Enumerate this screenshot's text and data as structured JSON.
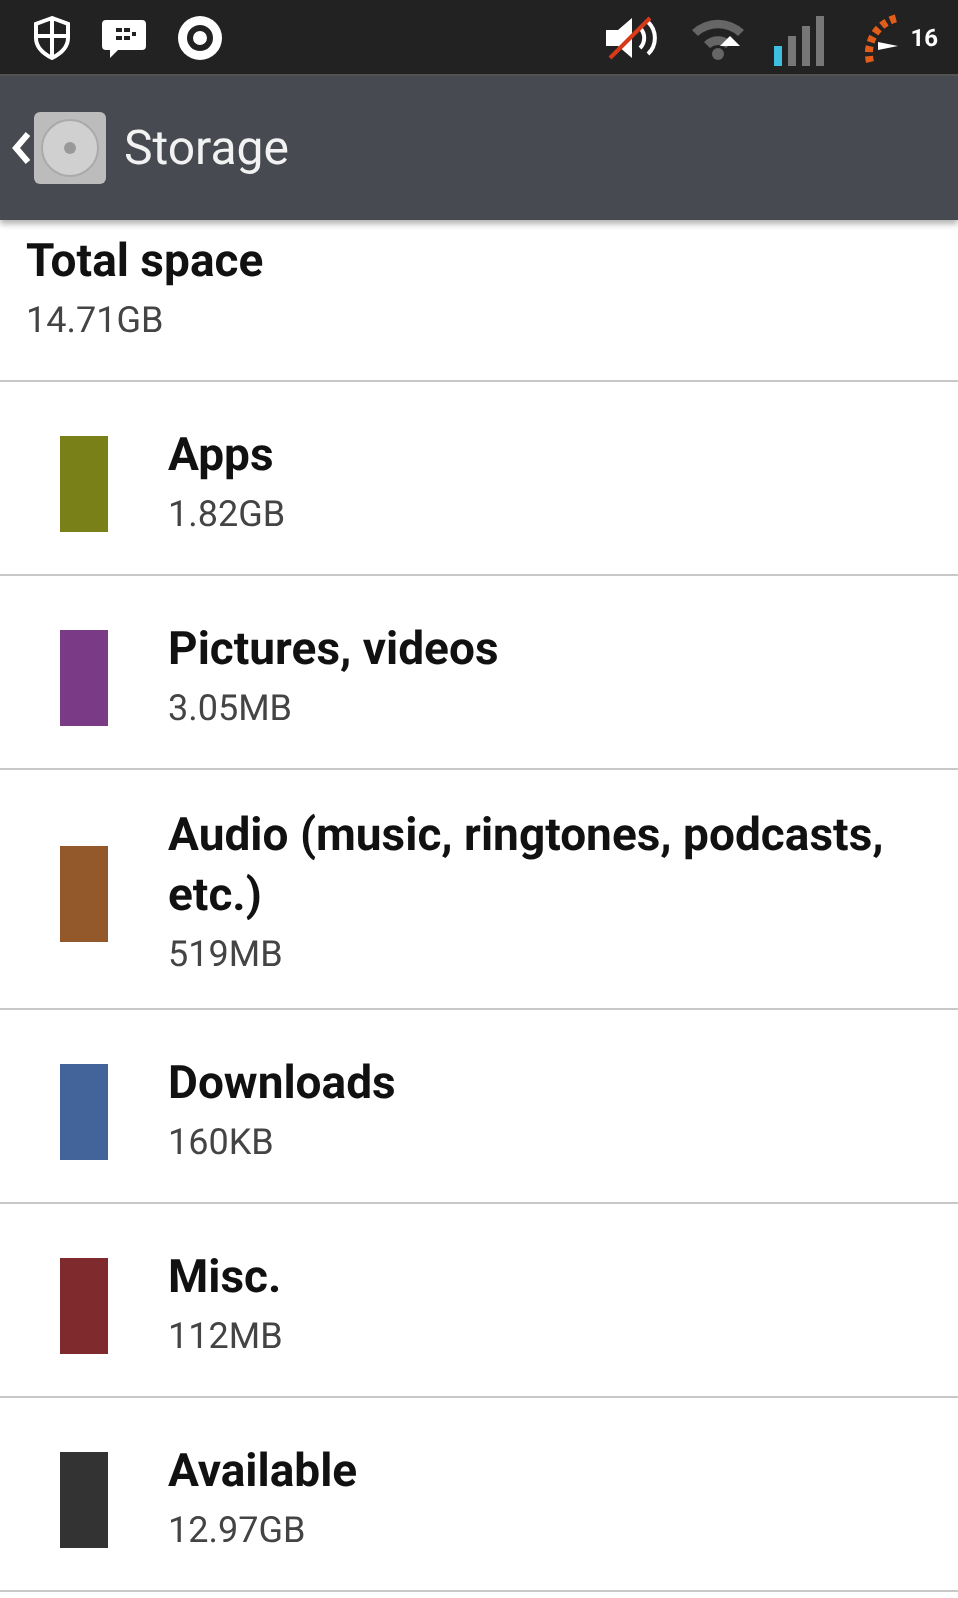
{
  "status_bar": {
    "battery_text": "16"
  },
  "action_bar": {
    "title": "Storage"
  },
  "total": {
    "title": "Total space",
    "value": "14.71GB"
  },
  "categories": [
    {
      "name": "Apps",
      "size": "1.82GB",
      "color": "#7a8018"
    },
    {
      "name": "Pictures, videos",
      "size": "3.05MB",
      "color": "#7b3a86"
    },
    {
      "name": "Audio (music, ringtones, podcasts, etc.)",
      "size": "519MB",
      "color": "#93592a"
    },
    {
      "name": "Downloads",
      "size": "160KB",
      "color": "#43649b"
    },
    {
      "name": "Misc.",
      "size": "112MB",
      "color": "#7f2a2c"
    },
    {
      "name": "Available",
      "size": "12.97GB",
      "color": "#333333"
    }
  ]
}
